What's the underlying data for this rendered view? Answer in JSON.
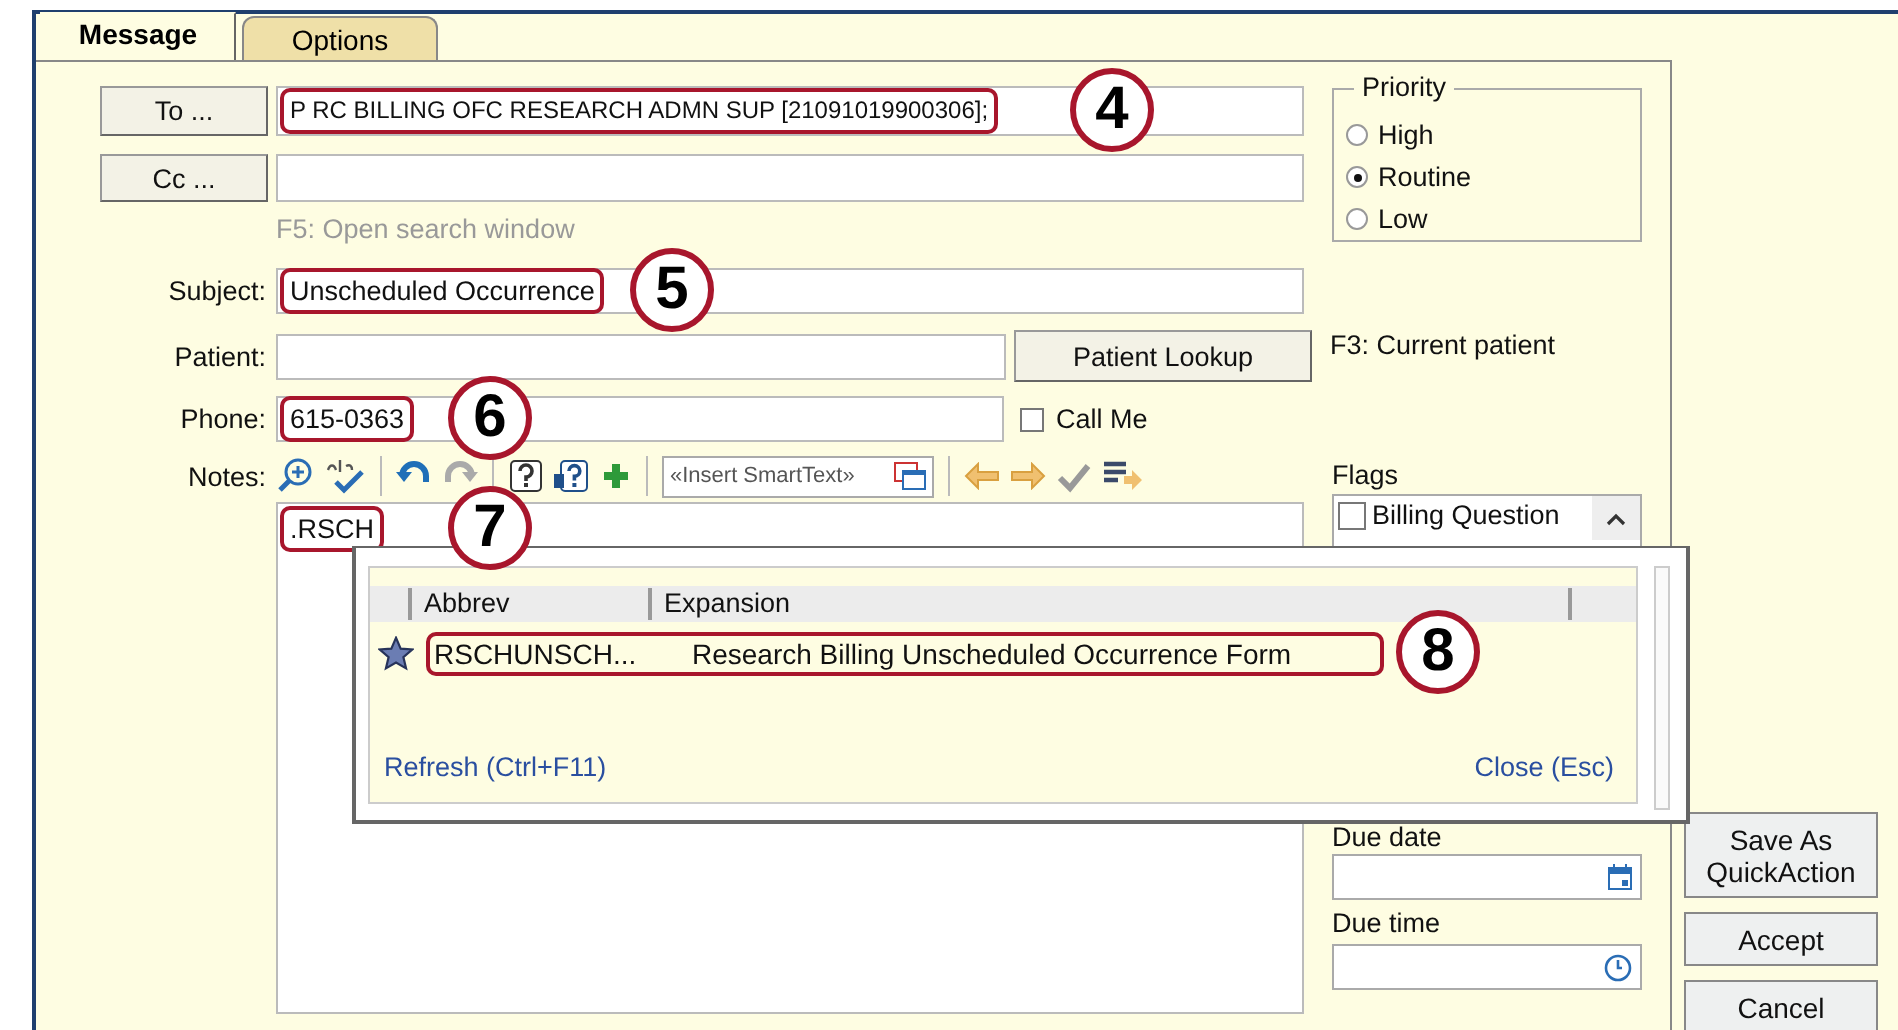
{
  "tabs": [
    {
      "label": "Message",
      "selected": true
    },
    {
      "label": "Options",
      "selected": false
    }
  ],
  "form": {
    "to_button": "To ...",
    "to_value": "P RC BILLING OFC RESEARCH ADMN SUP [21091019900306];",
    "to_callout": "4",
    "cc_button": "Cc ...",
    "search_hint": "F5: Open search window",
    "subject_label": "Subject:",
    "subject_value": "Unscheduled Occurrence",
    "subject_callout": "5",
    "patient_label": "Patient:",
    "patient_lookup_button": "Patient Lookup",
    "phone_label": "Phone:",
    "phone_value": "615-0363",
    "phone_callout": "6",
    "call_me": {
      "label": "Call Me",
      "checked": false
    },
    "notes_label": "Notes:",
    "smarttext_placeholder": "«Insert SmartText»",
    "notes_value": ".RSCH",
    "notes_callout": "7"
  },
  "side": {
    "priority": {
      "title": "Priority",
      "options": [
        {
          "label": "High",
          "selected": false
        },
        {
          "label": "Routine",
          "selected": true
        },
        {
          "label": "Low",
          "selected": false
        }
      ]
    },
    "patient_hint": "F3: Current patient",
    "flags": {
      "title": "Flags",
      "items": [
        {
          "label": "Billing Question",
          "checked": false
        }
      ]
    },
    "due_date_label": "Due date",
    "due_time_label": "Due time"
  },
  "popup": {
    "columns": [
      "Abbrev",
      "Expansion"
    ],
    "rows": [
      {
        "abbrev": "RSCHUNSCH...",
        "expansion": "Research Billing Unscheduled Occurrence Form",
        "favorite": true
      }
    ],
    "callout": "8",
    "refresh_link": "Refresh (Ctrl+F11)",
    "close_link": "Close (Esc)"
  },
  "buttons": [
    "Save As QuickAction",
    "Accept",
    "Cancel"
  ]
}
